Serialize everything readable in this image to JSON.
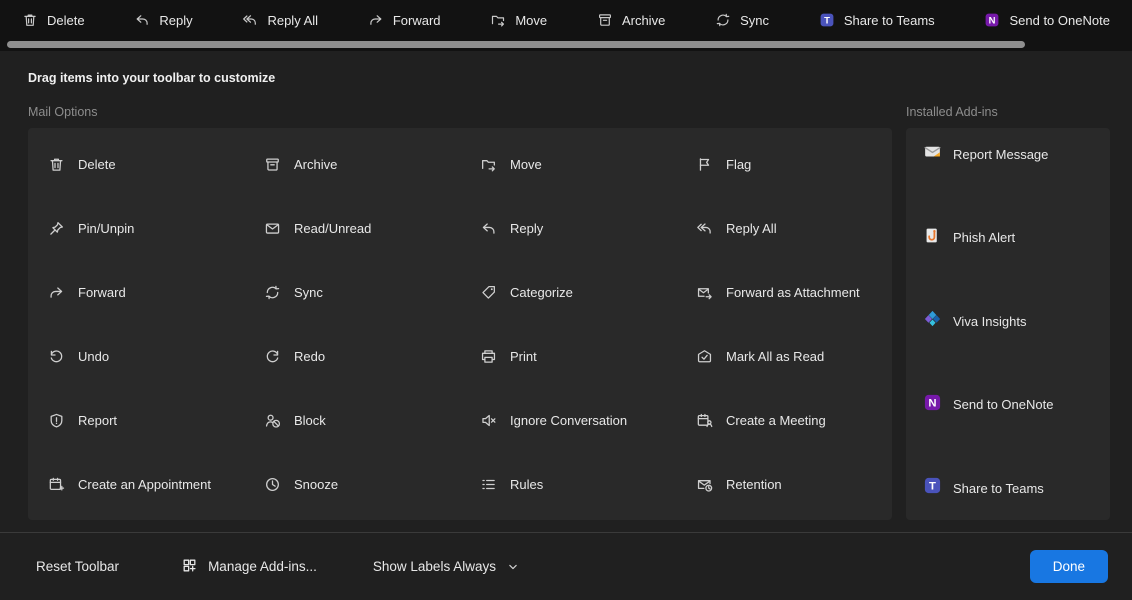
{
  "toolbar": {
    "items": [
      {
        "label": "Delete",
        "icon": "i-trash"
      },
      {
        "label": "Reply",
        "icon": "i-reply"
      },
      {
        "label": "Reply All",
        "icon": "i-reply-all"
      },
      {
        "label": "Forward",
        "icon": "i-forward"
      },
      {
        "label": "Move",
        "icon": "i-move"
      },
      {
        "label": "Archive",
        "icon": "i-archive"
      },
      {
        "label": "Sync",
        "icon": "i-sync"
      },
      {
        "label": "Share to Teams",
        "icon": "i-teams"
      },
      {
        "label": "Send to OneNote",
        "icon": "i-onenote"
      }
    ]
  },
  "heading": "Drag items into your toolbar to customize",
  "mail_options": {
    "title": "Mail Options",
    "items": [
      {
        "label": "Delete",
        "icon": "i-trash"
      },
      {
        "label": "Archive",
        "icon": "i-archive"
      },
      {
        "label": "Move",
        "icon": "i-move"
      },
      {
        "label": "Flag",
        "icon": "i-flag"
      },
      {
        "label": "Pin/Unpin",
        "icon": "i-pin"
      },
      {
        "label": "Read/Unread",
        "icon": "i-readunread"
      },
      {
        "label": "Reply",
        "icon": "i-reply"
      },
      {
        "label": "Reply All",
        "icon": "i-reply-all"
      },
      {
        "label": "Forward",
        "icon": "i-forward"
      },
      {
        "label": "Sync",
        "icon": "i-sync"
      },
      {
        "label": "Categorize",
        "icon": "i-categorize"
      },
      {
        "label": "Forward as Attachment",
        "icon": "i-fwd-attach"
      },
      {
        "label": "Undo",
        "icon": "i-undo"
      },
      {
        "label": "Redo",
        "icon": "i-redo"
      },
      {
        "label": "Print",
        "icon": "i-print"
      },
      {
        "label": "Mark All as Read",
        "icon": "i-markallread"
      },
      {
        "label": "Report",
        "icon": "i-report"
      },
      {
        "label": "Block",
        "icon": "i-block"
      },
      {
        "label": "Ignore Conversation",
        "icon": "i-ignore"
      },
      {
        "label": "Create a Meeting",
        "icon": "i-meeting"
      },
      {
        "label": "Create an Appointment",
        "icon": "i-appointment"
      },
      {
        "label": "Snooze",
        "icon": "i-snooze"
      },
      {
        "label": "Rules",
        "icon": "i-rules"
      },
      {
        "label": "Retention",
        "icon": "i-retention"
      }
    ]
  },
  "addins": {
    "title": "Installed Add-ins",
    "items": [
      {
        "label": "Report Message",
        "icon": "i-addin-reportmsg"
      },
      {
        "label": "Phish Alert",
        "icon": "i-addin-phish"
      },
      {
        "label": "Viva Insights",
        "icon": "i-addin-viva"
      },
      {
        "label": "Send to OneNote",
        "icon": "i-onenote"
      },
      {
        "label": "Share to Teams",
        "icon": "i-teams"
      }
    ]
  },
  "footer": {
    "reset_label": "Reset Toolbar",
    "manage_label": "Manage Add-ins...",
    "labels_label": "Show Labels Always",
    "done_label": "Done"
  },
  "colors": {
    "accent": "#1877e2",
    "teams": "#4a53bb",
    "onenote": "#7719aa",
    "panel": "#292929",
    "page_bg": "#202020",
    "topbar_bg": "#121212"
  }
}
